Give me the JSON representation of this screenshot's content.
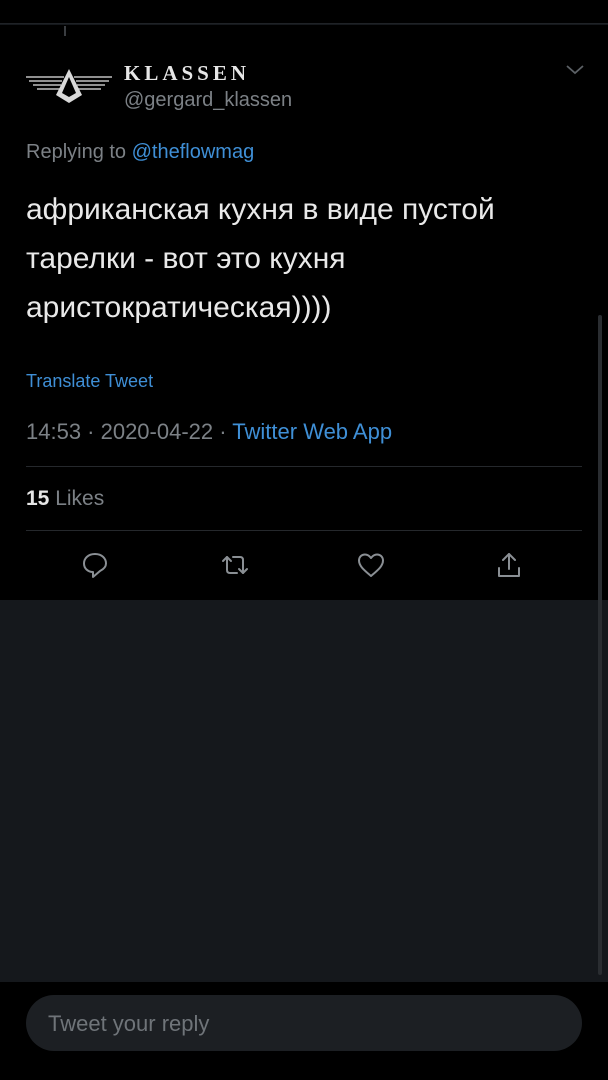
{
  "tweet": {
    "display_name": "KLASSEN",
    "handle": "@gergard_klassen",
    "replying_prefix": "Replying to",
    "replying_to": "@theflowmag",
    "text": "африканская кухня в виде пустой тарелки - вот это кухня аристократическая))))",
    "translate_label": "Translate Tweet",
    "timestamp": "14:53 · 2020-04-22 ·",
    "source": "Twitter Web App",
    "likes_count": "15",
    "likes_label": "Likes"
  },
  "actions": [
    {
      "icon": "reply-icon"
    },
    {
      "icon": "retweet-icon"
    },
    {
      "icon": "like-icon"
    },
    {
      "icon": "share-icon"
    }
  ],
  "reply": {
    "placeholder": "Tweet your reply"
  },
  "colors": {
    "background": "#000000",
    "empty_area": "#15181c",
    "link_blue": "#3f8fd6",
    "muted_gray": "#7c8186"
  }
}
